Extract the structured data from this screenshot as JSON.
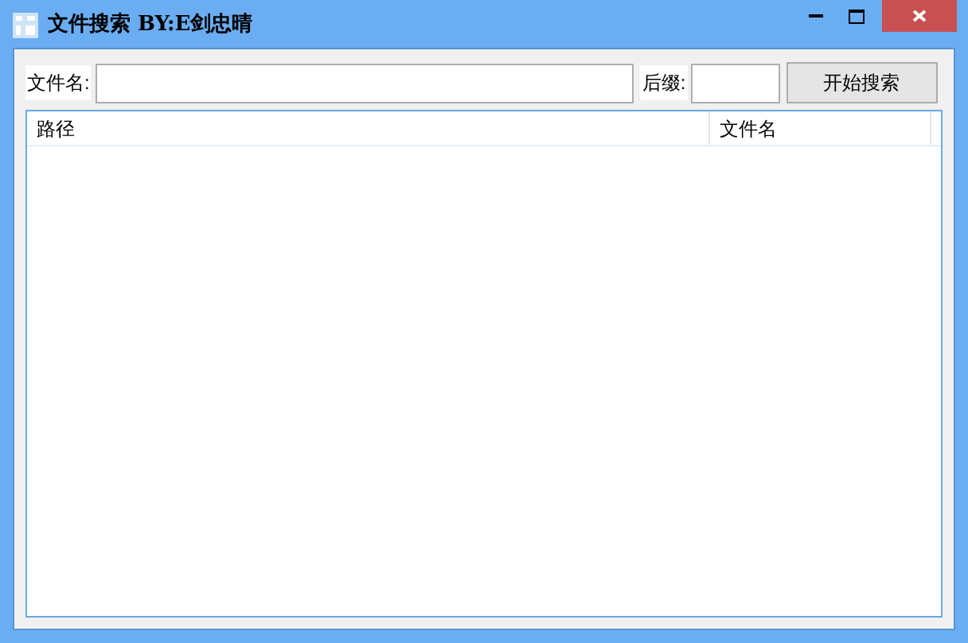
{
  "window": {
    "title": "文件搜索 BY:E剑忠晴"
  },
  "filename_label": "文件名:",
  "suffix_label": "后缀:",
  "search_button": "开始搜索",
  "table": {
    "columns": [
      "路径",
      "文件名"
    ]
  }
}
